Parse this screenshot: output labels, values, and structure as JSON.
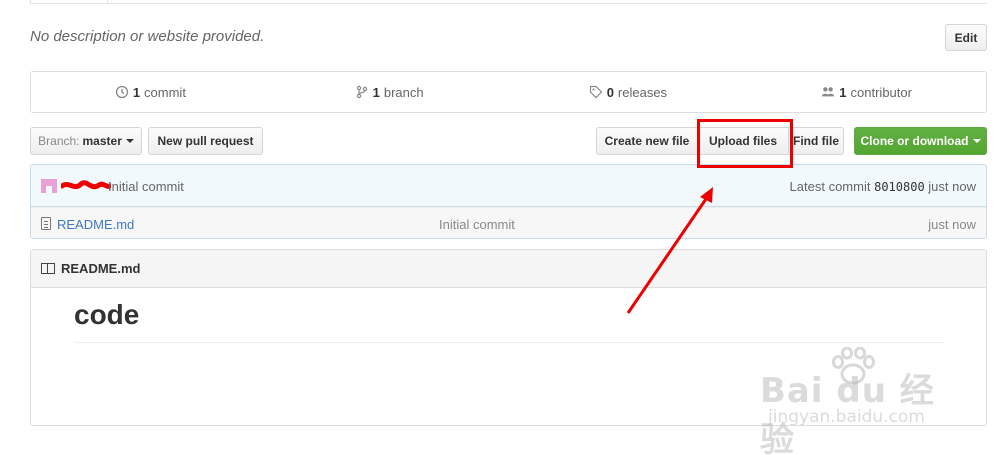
{
  "repo": {
    "description": "No description or website provided.",
    "edit_label": "Edit"
  },
  "stats": {
    "commits_count": "1",
    "commits_label": "commit",
    "branches_count": "1",
    "branches_label": "branch",
    "releases_count": "0",
    "releases_label": "releases",
    "contributors_count": "1",
    "contributors_label": "contributor"
  },
  "toolbar": {
    "branch_prefix": "Branch:",
    "branch_name": "master",
    "new_pull_request": "New pull request",
    "create_new_file": "Create new file",
    "upload_files": "Upload files",
    "find_file": "Find file",
    "clone_or_download": "Clone or download"
  },
  "commit": {
    "message": "Initial commit",
    "latest_prefix": "Latest commit",
    "sha": "8010800",
    "age": "just now"
  },
  "files": [
    {
      "name": "README.md",
      "message": "Initial commit",
      "age": "just now"
    }
  ],
  "readme": {
    "title": "README.md",
    "heading": "code"
  },
  "watermark": {
    "main": "Bai du 经验",
    "sub": "jingyan.baidu.com"
  },
  "colors": {
    "accent_link": "#4078c0",
    "clone_green": "#55a532",
    "annotation_red": "#ee0000"
  }
}
